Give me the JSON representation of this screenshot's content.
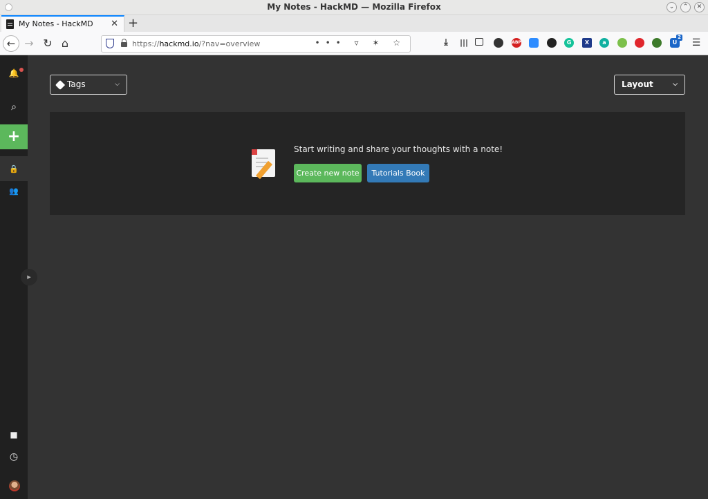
{
  "window": {
    "title": "My Notes - HackMD — Mozilla Firefox"
  },
  "tabs": [
    {
      "title": "My Notes - HackMD",
      "close": "✕"
    }
  ],
  "newtab": "+",
  "nav": {
    "back": "←",
    "forward": "→",
    "reload": "↻",
    "home": "⌂",
    "url_prefix": "https://",
    "url_host": "hackmd.io",
    "url_path": "/?nav=overview",
    "url_actions": "••• ▿ ✶ ☆",
    "menu": "☰",
    "ext_badge": "2"
  },
  "sidebar": {
    "bell": "🔔",
    "search": "⌕",
    "add": "+",
    "lock": "🔒",
    "group": "👥",
    "bookmark": "■",
    "history": "◷",
    "collapse": "▸"
  },
  "filters": {
    "tags_label": "Tags",
    "layout_label": "Layout",
    "chevron": "⌵"
  },
  "empty_state": {
    "message": "Start writing and share your thoughts with a note!",
    "create_button": "Create new note",
    "tutorials_button": "Tutorials Book"
  },
  "colors": {
    "green": "#5cb85c",
    "blue": "#337ab7",
    "bg": "#333333",
    "sidebar": "#202020",
    "panel": "#252525"
  }
}
